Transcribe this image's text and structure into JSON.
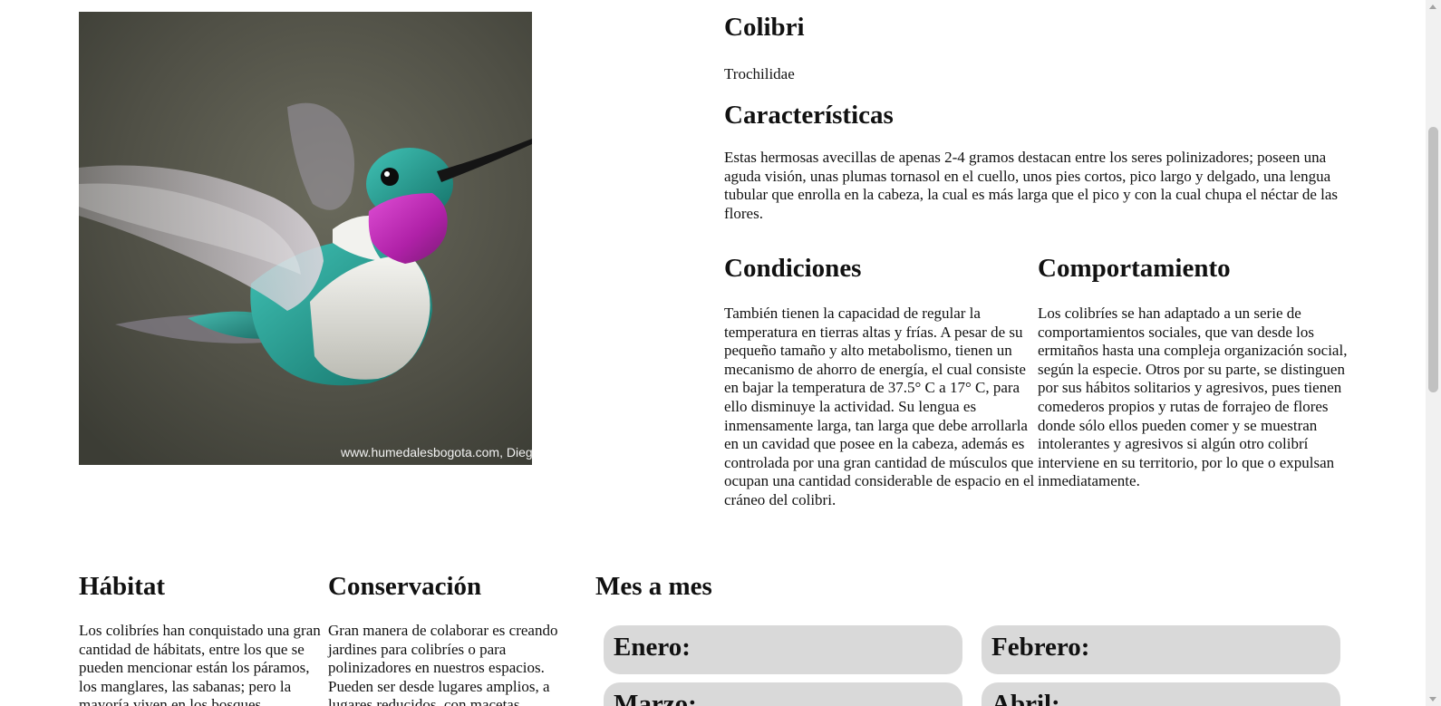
{
  "photo": {
    "watermark": "www.humedalesbogota.com, Dieg"
  },
  "header": {
    "title": "Colibri",
    "scientific_name": "Trochilidae"
  },
  "sections": {
    "caracteristicas": {
      "heading": "Características",
      "text": "Estas hermosas avecillas de apenas 2-4 gramos destacan entre los seres polinizadores; poseen una aguda visión, unas plumas tornasol en el cuello, unos pies cortos, pico largo y delgado, una lengua tubular que enrolla en la cabeza, la cual es más larga que el pico y con la cual chupa el néctar de las flores."
    },
    "condiciones": {
      "heading": "Condiciones",
      "text": "También tienen la capacidad de regular la temperatura en tierras altas y frías. A pesar de su pequeño tamaño y alto metabolismo, tienen un mecanismo de ahorro de energía, el cual consiste en bajar la temperatura de 37.5° C a 17° C, para ello disminuye la actividad. Su lengua es inmensamente larga, tan larga que debe arrollarla en un cavidad que posee en la cabeza, además es controlada por una gran cantidad de músculos que ocupan una cantidad considerable de espacio en el cráneo del colibri."
    },
    "comportamiento": {
      "heading": "Comportamiento",
      "text": "Los colibríes se han adaptado a un serie de comportamientos sociales, que van desde los ermitaños hasta una compleja organización social, según la especie. Otros por su parte, se distinguen por sus hábitos solitarios y agresivos, pues tienen comederos propios y rutas de forrajeo de flores donde sólo ellos pueden comer y se muestran intolerantes y agresivos si algún otro colibrí interviene en su territorio, por lo que o expulsan inmediatamente."
    },
    "habitat": {
      "heading": "Hábitat",
      "text": "Los colibríes han conquistado una gran cantidad de hábitats, entre los que se pueden mencionar están los páramos, los manglares, las sabanas; pero la mayoría viven en los bosques"
    },
    "conservacion": {
      "heading": "Conservación",
      "text": "Gran manera de colaborar es creando jardines para colibríes o para polinizadores en nuestros espacios. Pueden ser desde lugares amplios, a lugares reducidos, con macetas"
    }
  },
  "mes_a_mes": {
    "heading": "Mes a mes",
    "months": [
      "Enero:",
      "Febrero:",
      "Marzo:",
      "Abril:"
    ]
  },
  "colors": {
    "month_card_bg": "#d9d9d9",
    "photo_bg": "#555548",
    "throat_magenta": "#c22fb8",
    "plumage_teal": "#1f8f8a"
  }
}
